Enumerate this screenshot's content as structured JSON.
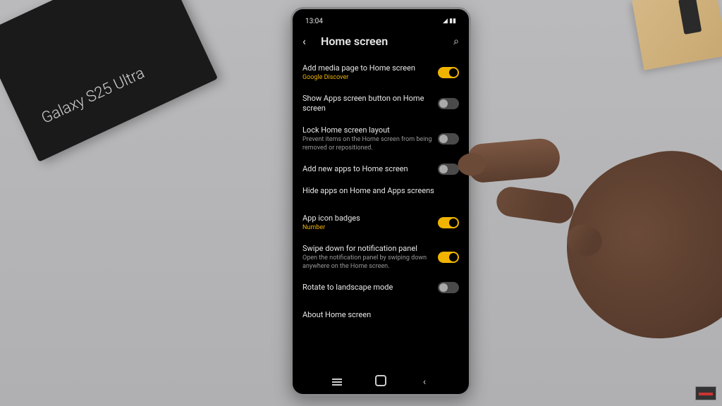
{
  "environment": {
    "product_box_text": "Galaxy S25 Ultra"
  },
  "status_bar": {
    "time": "13:04",
    "icons": "◢ ▮▮"
  },
  "header": {
    "back_glyph": "‹",
    "title": "Home screen",
    "search_glyph": "⌕"
  },
  "settings": [
    {
      "id": "media-page",
      "title": "Add media page to Home screen",
      "sub": "Google Discover",
      "sub_accent": true,
      "toggle": "on"
    },
    {
      "id": "apps-button",
      "title": "Show Apps screen button on Home screen",
      "sub": "",
      "toggle": "off"
    },
    {
      "id": "lock-layout",
      "title": "Lock Home screen layout",
      "sub": "Prevent items on the Home screen from being removed or repositioned.",
      "toggle": "off"
    },
    {
      "id": "add-new-apps",
      "title": "Add new apps to Home screen",
      "sub": "",
      "toggle": "off"
    },
    {
      "id": "hide-apps",
      "title": "Hide apps on Home and Apps screens",
      "sub": "",
      "toggle": ""
    },
    {
      "id": "icon-badges",
      "title": "App icon badges",
      "sub": "Number",
      "sub_accent": true,
      "toggle": "on"
    },
    {
      "id": "swipe-notif",
      "title": "Swipe down for notification panel",
      "sub": "Open the notification panel by swiping down anywhere on the Home screen.",
      "toggle": "on"
    },
    {
      "id": "rotate",
      "title": "Rotate to landscape mode",
      "sub": "",
      "toggle": "off"
    },
    {
      "id": "about",
      "title": "About Home screen",
      "sub": "",
      "toggle": ""
    }
  ],
  "nav": {
    "recent": "recent",
    "home": "home",
    "back": "‹"
  }
}
